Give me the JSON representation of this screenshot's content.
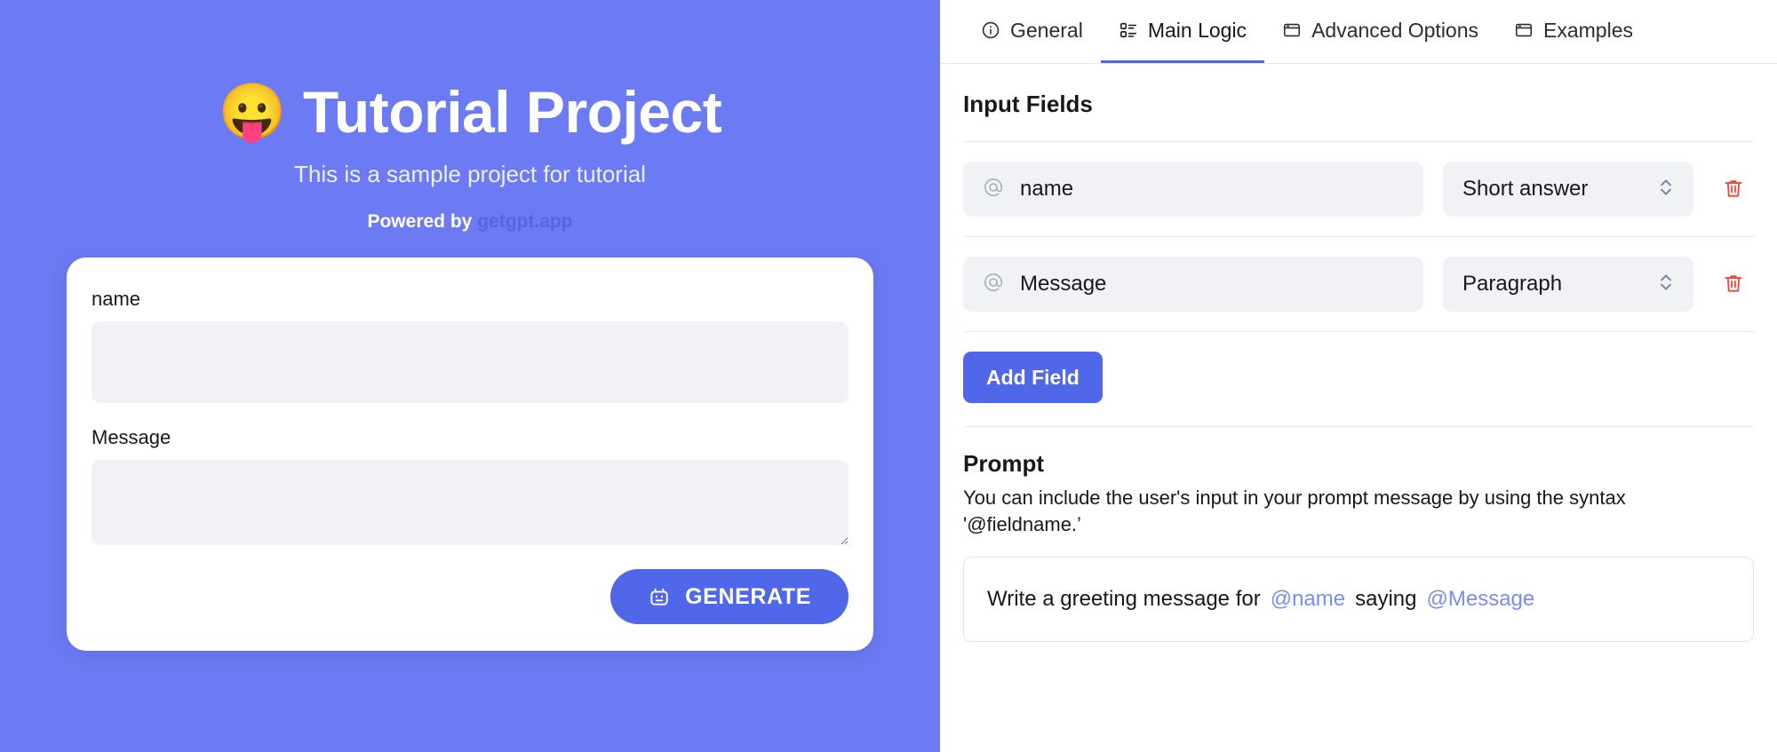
{
  "preview": {
    "emoji": "😛",
    "title": "Tutorial Project",
    "subtitle": "This is a sample project for tutorial",
    "powered_prefix": "Powered by",
    "powered_link": "getgpt.app",
    "accent_color": "#6C7BF4",
    "button_color": "#4F67E8",
    "fields": [
      {
        "label": "name",
        "value": "",
        "placeholder": ""
      },
      {
        "label": "Message",
        "value": "",
        "placeholder": ""
      }
    ],
    "generate_label": "GENERATE",
    "generate_icon": "robot-icon"
  },
  "editor": {
    "tabs": [
      {
        "label": "General",
        "icon": "info-circle-icon",
        "active": false
      },
      {
        "label": "Main Logic",
        "icon": "list-layout-icon",
        "active": true
      },
      {
        "label": "Advanced Options",
        "icon": "window-icon",
        "active": false
      },
      {
        "label": "Examples",
        "icon": "window-icon",
        "active": false
      }
    ],
    "input_fields": {
      "heading": "Input Fields",
      "rows": [
        {
          "at": "@",
          "name": "name",
          "type": "Short answer",
          "delete_icon": "trash-icon"
        },
        {
          "at": "@",
          "name": "Message",
          "type": "Paragraph",
          "delete_icon": "trash-icon"
        }
      ],
      "add_label": "Add Field"
    },
    "prompt": {
      "heading": "Prompt",
      "help": "You can include the user's input in your prompt message by using the syntax '@fieldname.’",
      "text_parts": [
        {
          "text": "Write a greeting message for",
          "token": false
        },
        {
          "text": "@name",
          "token": true
        },
        {
          "text": "saying",
          "token": false
        },
        {
          "text": "@Message",
          "token": true
        }
      ],
      "token_color": "#7B8CF4"
    }
  }
}
